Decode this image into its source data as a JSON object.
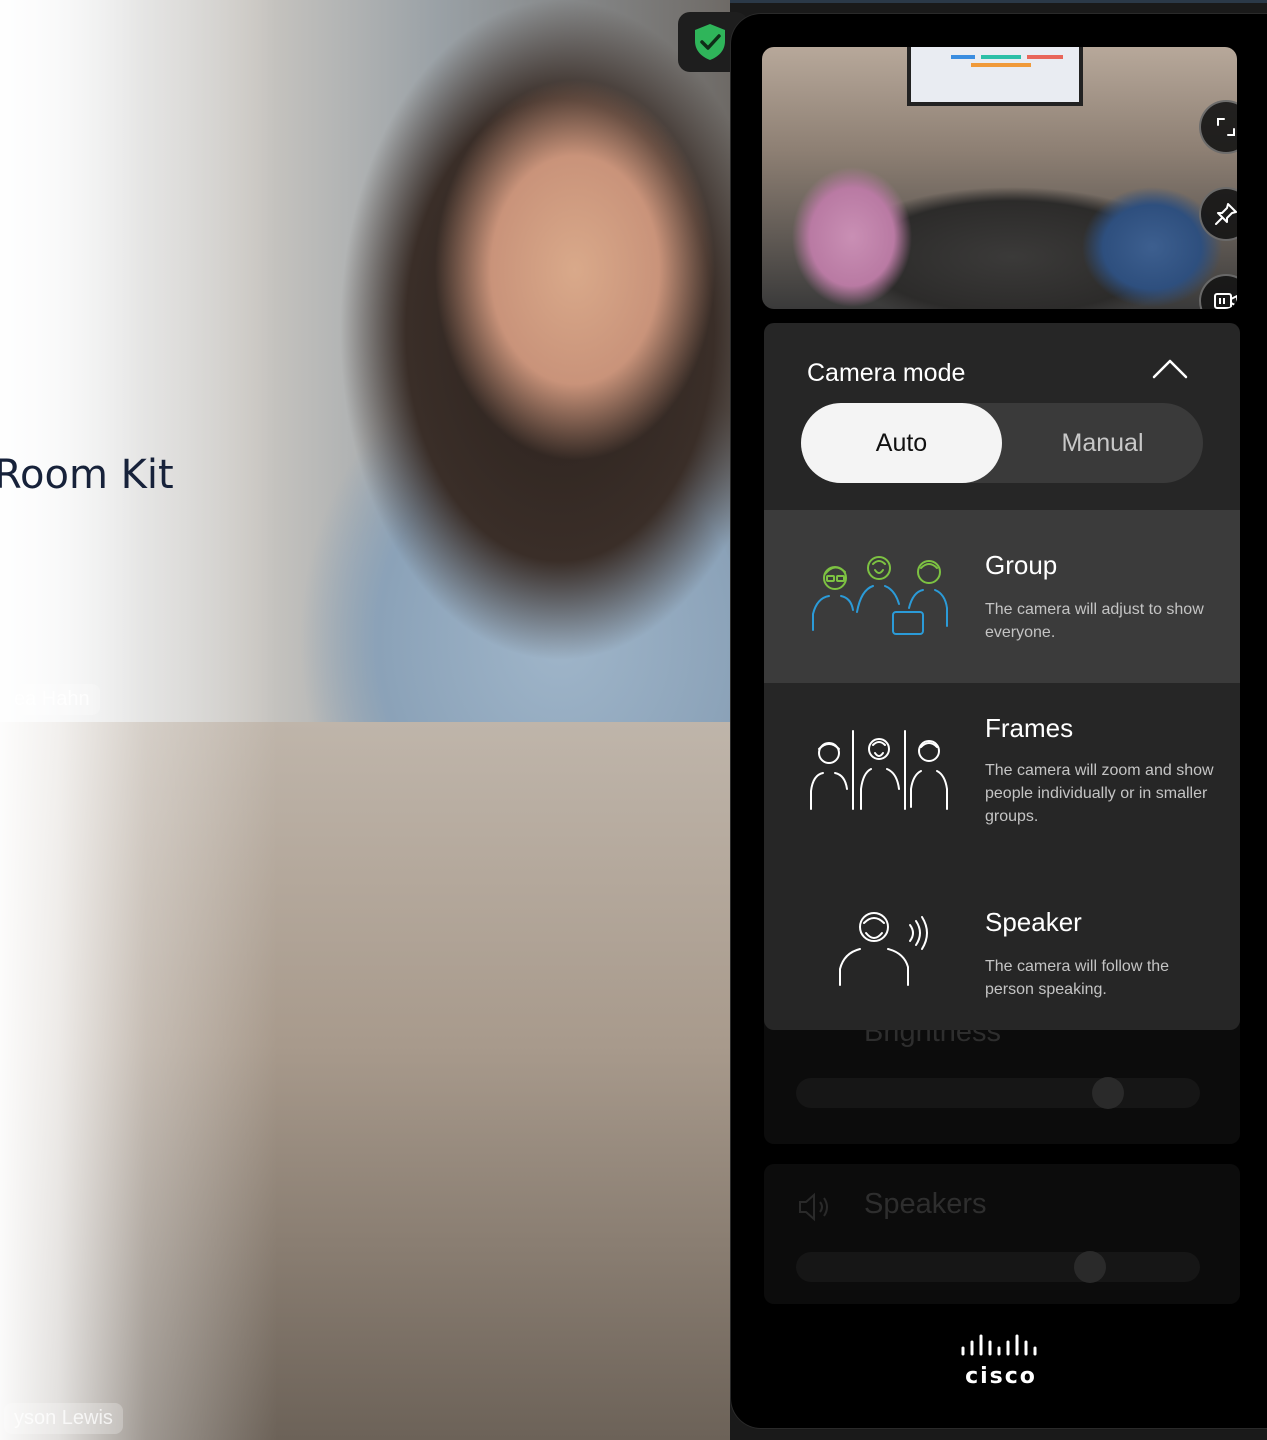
{
  "background": {
    "room_title": "Room Kit",
    "participants": [
      {
        "name_tag": "ea Hahn"
      },
      {
        "name_tag": "yson Lewis"
      }
    ],
    "security_icon": "shield-check-icon",
    "security_color": "#2fb55a"
  },
  "panel": {
    "selfview": {
      "buttons": [
        "fullscreen-icon",
        "pin-icon",
        "camera-control-icon"
      ]
    },
    "camera_mode": {
      "title": "Camera mode",
      "collapse_icon": "chevron-up-icon",
      "segment": {
        "options": [
          "Auto",
          "Manual"
        ],
        "selected": "Auto"
      },
      "modes": [
        {
          "name": "Group",
          "description": "The camera will adjust to show everyone.",
          "icon": "group-people-icon",
          "selected": true
        },
        {
          "name": "Frames",
          "description": "The camera will zoom and show people individually or in smaller groups.",
          "icon": "frames-people-icon",
          "selected": false
        },
        {
          "name": "Speaker",
          "description": "The camera will follow the person speaking.",
          "icon": "speaker-person-icon",
          "selected": false
        }
      ]
    },
    "underlying": {
      "brightness_label": "Brightness",
      "speakers_label": "Speakers"
    },
    "brand": "cisco",
    "accent_green": "#7dc242",
    "accent_blue": "#2b9bd8"
  }
}
